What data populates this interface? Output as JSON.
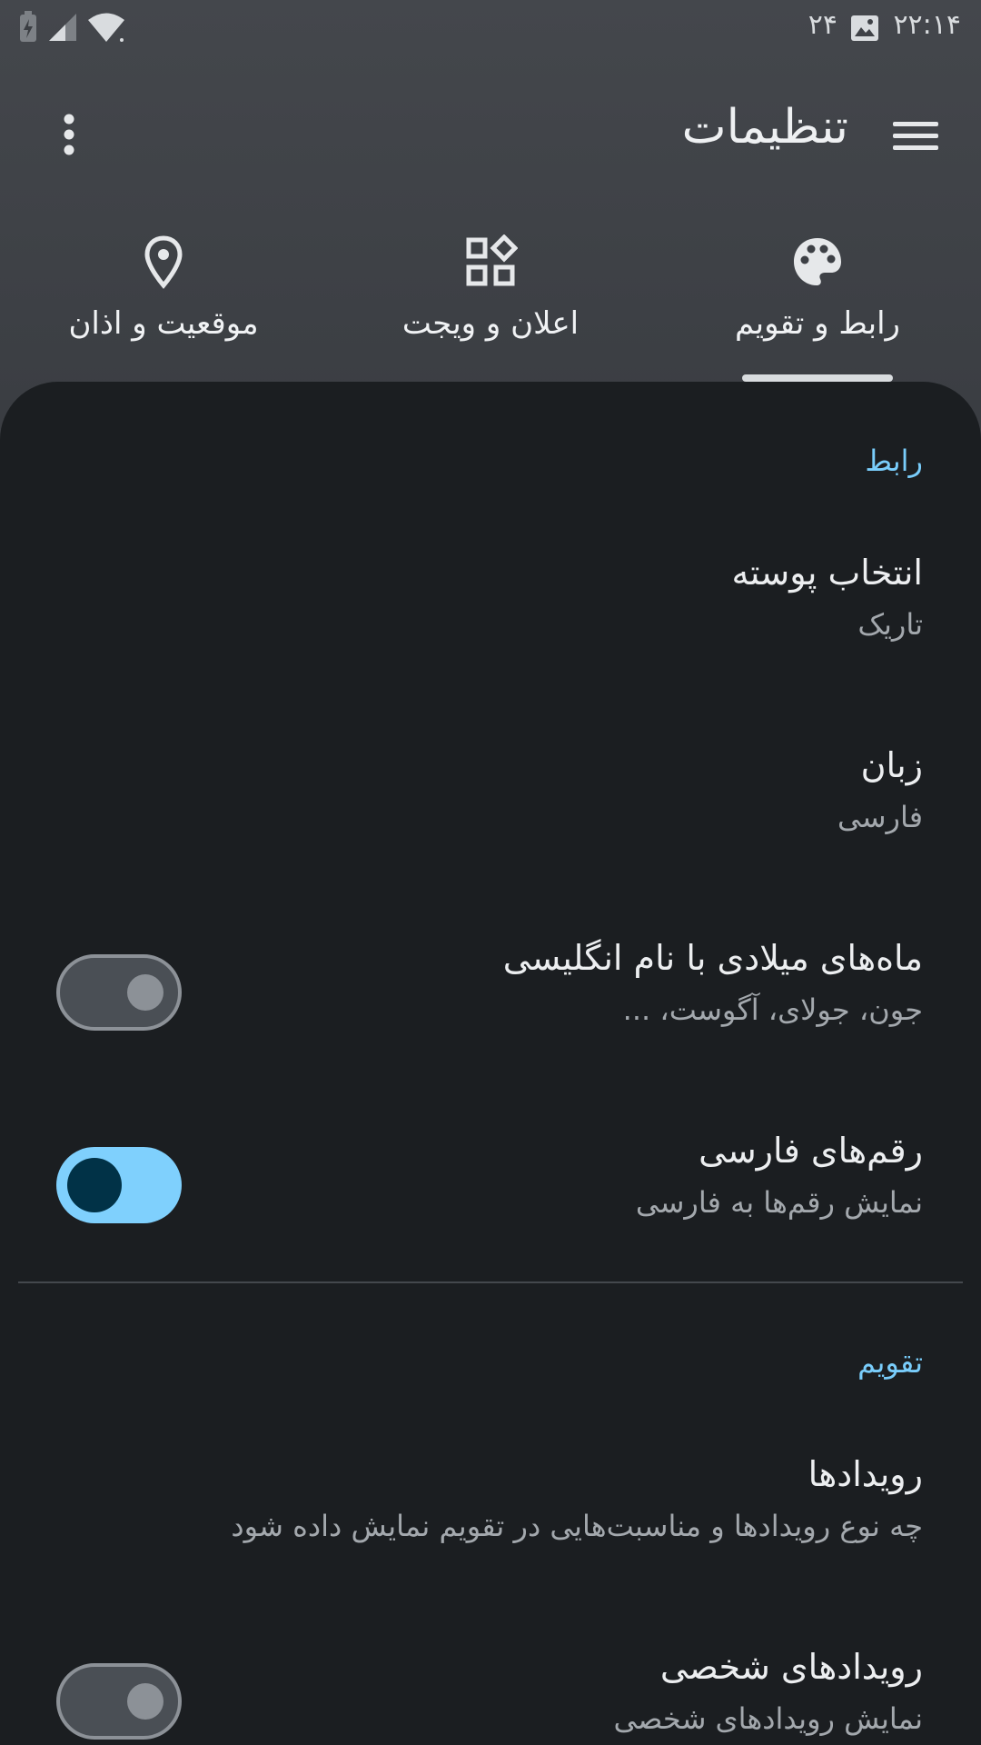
{
  "status_bar": {
    "time": "۲۲:۱۴",
    "date": "۲۴"
  },
  "app_bar": {
    "title": "تنظیمات"
  },
  "tabs": [
    {
      "label": "رابط و تقویم",
      "icon": "palette-icon",
      "selected": true
    },
    {
      "label": "اعلان و ویجت",
      "icon": "widgets-icon",
      "selected": false
    },
    {
      "label": "موقعیت و اذان",
      "icon": "location-pin-icon",
      "selected": false
    }
  ],
  "sections": {
    "interface": {
      "header": "رابط",
      "theme": {
        "title": "انتخاب پوسته",
        "value": "تاریک"
      },
      "language": {
        "title": "زبان",
        "value": "فارسی"
      },
      "english_months": {
        "title": "ماه‌های میلادی با نام انگلیسی",
        "summary": "جون، جولای، آگوست، ...",
        "enabled": false
      },
      "persian_digits": {
        "title": "رقم‌های فارسی",
        "summary": "نمایش رقم‌ها به فارسی",
        "enabled": true
      }
    },
    "calendar": {
      "header": "تقویم",
      "events": {
        "title": "رویدادها",
        "summary": "چه نوع رویدادها و مناسبت‌هایی در تقویم نمایش داده شود"
      },
      "personal_events": {
        "title": "رویدادهای شخصی",
        "summary": "نمایش رویدادهای شخصی",
        "enabled": false
      }
    }
  },
  "colors": {
    "accent": "#79cdfb",
    "background": "#1b1e21",
    "header": "#3a3d42"
  }
}
